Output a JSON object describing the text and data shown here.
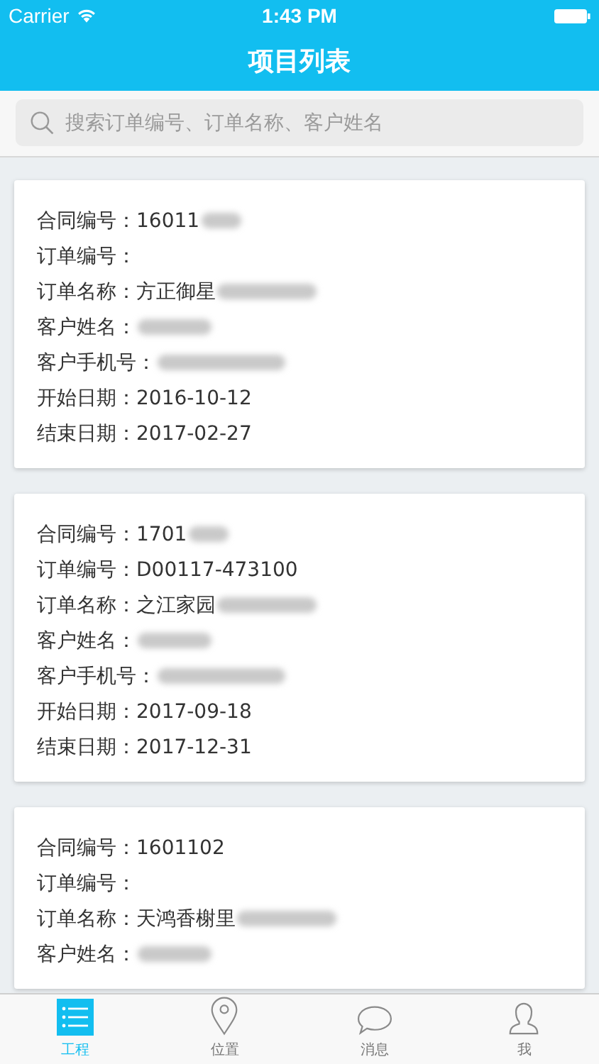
{
  "status_bar": {
    "carrier": "Carrier",
    "time": "1:43 PM"
  },
  "nav": {
    "title": "项目列表"
  },
  "search": {
    "placeholder": "搜索订单编号、订单名称、客户姓名"
  },
  "projects": [
    {
      "fields": [
        {
          "label": "合同编号：",
          "value": "16011",
          "redacted": true
        },
        {
          "label": "订单编号：",
          "redacted": false
        },
        {
          "label": "订单名称：",
          "value": "方正御星",
          "redacted": true
        },
        {
          "label": "客户姓名：",
          "redacted": true
        },
        {
          "label": "客户手机号：",
          "redacted": true
        },
        {
          "label": "开始日期：",
          "value": "2016-10-12",
          "redacted": false
        },
        {
          "label": "结束日期：",
          "value": "2017-02-27",
          "redacted": false
        }
      ]
    },
    {
      "fields": [
        {
          "label": "合同编号：",
          "value": "1701",
          "redacted": true
        },
        {
          "label": "订单编号：",
          "value": "D00117-473100",
          "redacted": false
        },
        {
          "label": "订单名称：",
          "value": "之江家园",
          "redacted": true
        },
        {
          "label": "客户姓名：",
          "redacted": true
        },
        {
          "label": "客户手机号：",
          "redacted": true
        },
        {
          "label": "开始日期：",
          "value": "2017-09-18",
          "redacted": false
        },
        {
          "label": "结束日期：",
          "value": "2017-12-31",
          "redacted": false
        }
      ]
    },
    {
      "fields": [
        {
          "label": "合同编号：",
          "value": "1601102",
          "redacted": false
        },
        {
          "label": "订单编号：",
          "redacted": false
        },
        {
          "label": "订单名称：",
          "value": "天鸿香榭里",
          "redacted": true
        },
        {
          "label": "客户姓名：",
          "redacted": true
        }
      ]
    }
  ],
  "tabs": [
    {
      "label": "工程",
      "kind": "list",
      "selected": true
    },
    {
      "label": "位置",
      "kind": "pin",
      "selected": false
    },
    {
      "label": "消息",
      "kind": "chat",
      "selected": false
    },
    {
      "label": "我",
      "kind": "person",
      "selected": false
    }
  ]
}
